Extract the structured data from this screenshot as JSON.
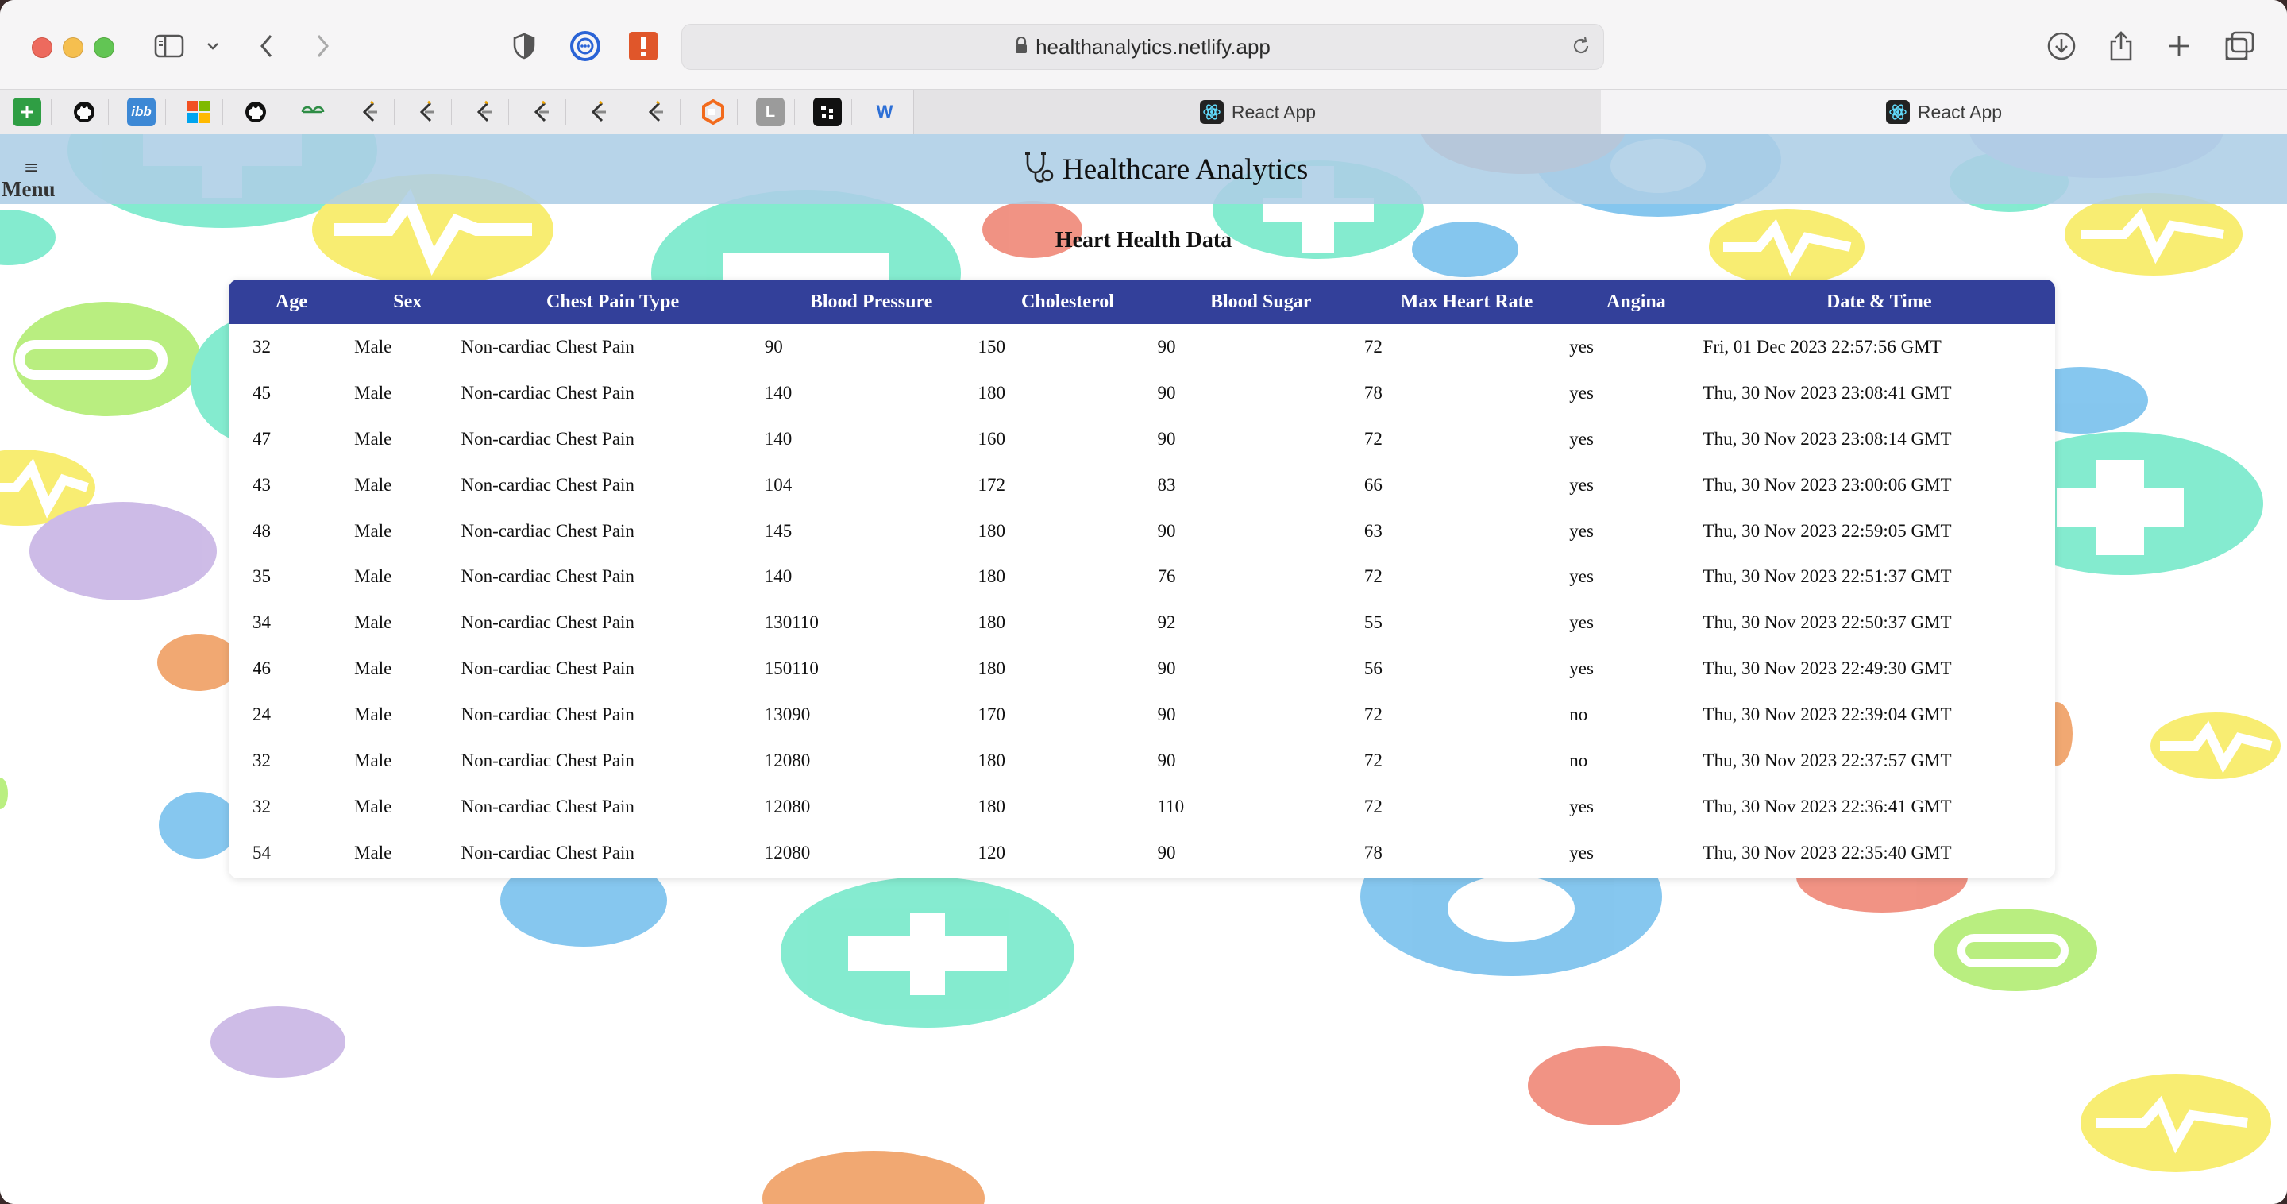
{
  "browser": {
    "url": "healthanalytics.netlify.app",
    "tabs": [
      {
        "title": "React App",
        "active": true
      },
      {
        "title": "React App",
        "active": false
      }
    ],
    "bookmark_icons": [
      "plus-square-icon",
      "github-icon",
      "ibb-icon",
      "microsoft-icon",
      "github-icon",
      "geeksforgeeks-icon",
      "leetcode-icon",
      "leetcode-icon",
      "leetcode-icon",
      "leetcode-icon",
      "leetcode-icon",
      "leetcode-icon",
      "hexagon-icon",
      "l-icon",
      "dots-icon",
      "w-icon"
    ],
    "ibb_label": "ibb",
    "l_label": "L",
    "w_label": "W"
  },
  "app": {
    "menu_icon": "≡",
    "menu_label": "Menu",
    "title": "Healthcare Analytics",
    "section_title": "Heart Health Data"
  },
  "table": {
    "headers": [
      "Age",
      "Sex",
      "Chest Pain Type",
      "Blood Pressure",
      "Cholesterol",
      "Blood Sugar",
      "Max Heart Rate",
      "Angina",
      "Date & Time"
    ],
    "rows": [
      [
        "32",
        "Male",
        "Non-cardiac Chest Pain",
        "90",
        "150",
        "90",
        "72",
        "yes",
        "Fri, 01 Dec 2023 22:57:56 GMT"
      ],
      [
        "45",
        "Male",
        "Non-cardiac Chest Pain",
        "140",
        "180",
        "90",
        "78",
        "yes",
        "Thu, 30 Nov 2023 23:08:41 GMT"
      ],
      [
        "47",
        "Male",
        "Non-cardiac Chest Pain",
        "140",
        "160",
        "90",
        "72",
        "yes",
        "Thu, 30 Nov 2023 23:08:14 GMT"
      ],
      [
        "43",
        "Male",
        "Non-cardiac Chest Pain",
        "104",
        "172",
        "83",
        "66",
        "yes",
        "Thu, 30 Nov 2023 23:00:06 GMT"
      ],
      [
        "48",
        "Male",
        "Non-cardiac Chest Pain",
        "145",
        "180",
        "90",
        "63",
        "yes",
        "Thu, 30 Nov 2023 22:59:05 GMT"
      ],
      [
        "35",
        "Male",
        "Non-cardiac Chest Pain",
        "140",
        "180",
        "76",
        "72",
        "yes",
        "Thu, 30 Nov 2023 22:51:37 GMT"
      ],
      [
        "34",
        "Male",
        "Non-cardiac Chest Pain",
        "130110",
        "180",
        "92",
        "55",
        "yes",
        "Thu, 30 Nov 2023 22:50:37 GMT"
      ],
      [
        "46",
        "Male",
        "Non-cardiac Chest Pain",
        "150110",
        "180",
        "90",
        "56",
        "yes",
        "Thu, 30 Nov 2023 22:49:30 GMT"
      ],
      [
        "24",
        "Male",
        "Non-cardiac Chest Pain",
        "13090",
        "170",
        "90",
        "72",
        "no",
        "Thu, 30 Nov 2023 22:39:04 GMT"
      ],
      [
        "32",
        "Male",
        "Non-cardiac Chest Pain",
        "12080",
        "180",
        "90",
        "72",
        "no",
        "Thu, 30 Nov 2023 22:37:57 GMT"
      ],
      [
        "32",
        "Male",
        "Non-cardiac Chest Pain",
        "12080",
        "180",
        "110",
        "72",
        "yes",
        "Thu, 30 Nov 2023 22:36:41 GMT"
      ],
      [
        "54",
        "Male",
        "Non-cardiac Chest Pain",
        "12080",
        "120",
        "90",
        "78",
        "yes",
        "Thu, 30 Nov 2023 22:35:40 GMT"
      ]
    ]
  },
  "colors": {
    "header_bg": "#33409a",
    "appbar_bg": "#adcee6",
    "teal": "#7eeacd",
    "yellow": "#f8ed6b",
    "blue": "#7fc4ee",
    "purple": "#cbb8e6",
    "orange": "#f0a36a",
    "green": "#b6ee7a",
    "coral": "#f08d7d"
  }
}
